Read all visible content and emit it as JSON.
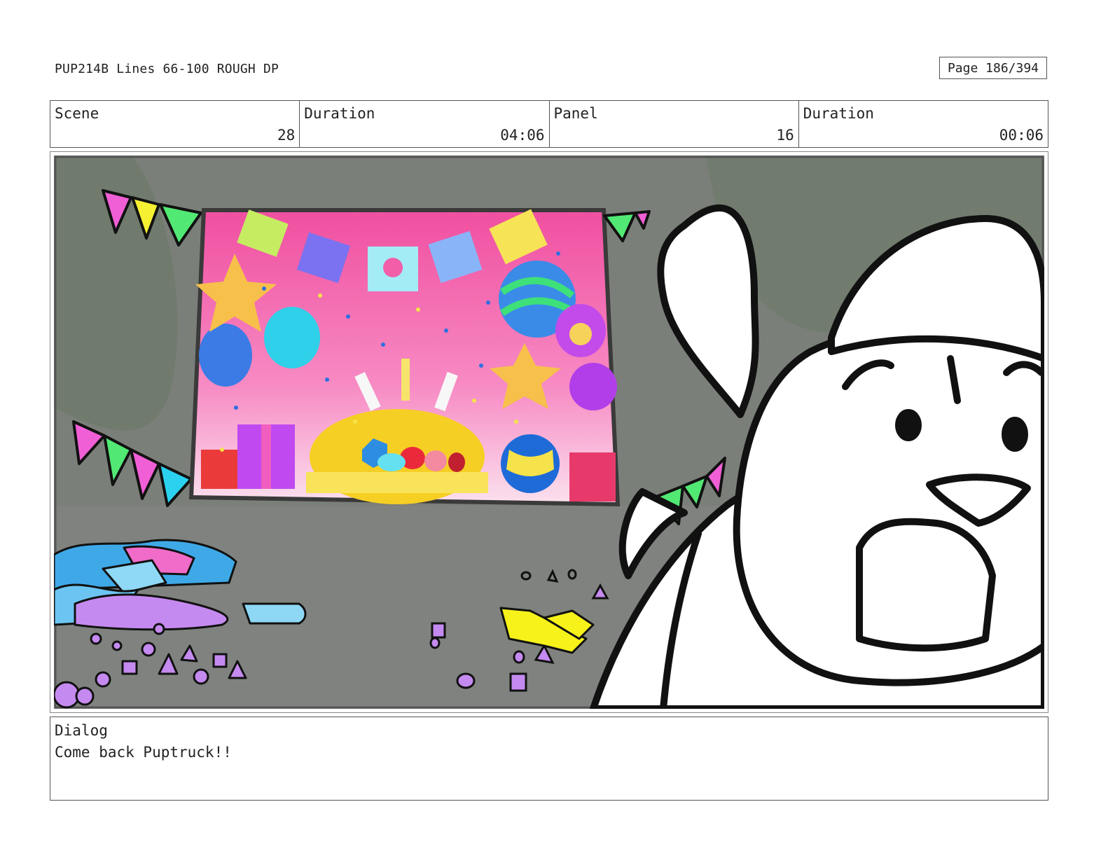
{
  "header": {
    "title": "PUP214B Lines 66-100 ROUGH DP",
    "page": "Page 186/394"
  },
  "info": {
    "scene_label": "Scene",
    "scene_value": "28",
    "duration_label": "Duration",
    "duration_value": "04:06",
    "panel_label": "Panel",
    "panel_value": "16",
    "panel_duration_label": "Duration",
    "panel_duration_value": "00:06"
  },
  "dialog": {
    "label": "Dialog",
    "text": "Come back Puptruck!!"
  },
  "colors": {
    "banner_pink": "#f25fa8",
    "background_gray": "#7a7d78",
    "outline": "#111111"
  }
}
